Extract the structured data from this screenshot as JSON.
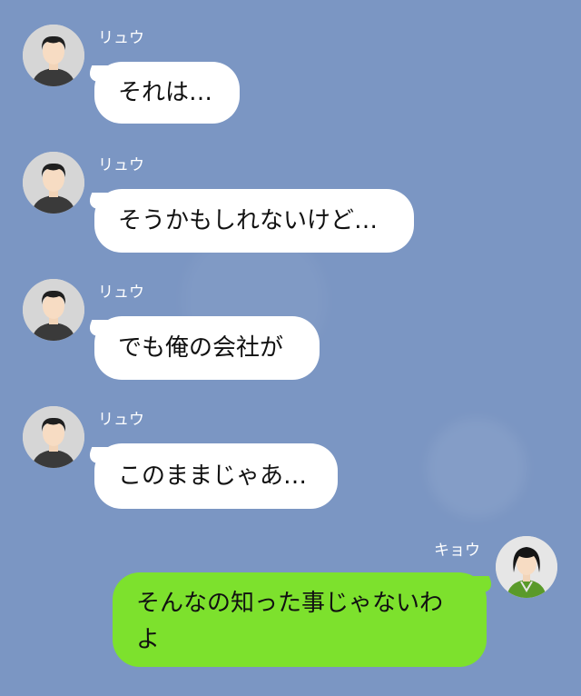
{
  "colors": {
    "background": "#7b96c3",
    "incoming_bubble": "#ffffff",
    "outgoing_bubble": "#7de12d"
  },
  "messages": [
    {
      "sender": "リュウ",
      "text": "それは…",
      "avatar": "man-avatar-icon"
    },
    {
      "sender": "リュウ",
      "text": "そうかもしれないけど…",
      "avatar": "man-avatar-icon"
    },
    {
      "sender": "リュウ",
      "text": "でも俺の会社が",
      "avatar": "man-avatar-icon"
    },
    {
      "sender": "リュウ",
      "text": "このままじゃあ…",
      "avatar": "man-avatar-icon"
    },
    {
      "sender": "キョウ",
      "text": "そんなの知った事じゃないわよ",
      "avatar": "woman-avatar-icon"
    }
  ]
}
